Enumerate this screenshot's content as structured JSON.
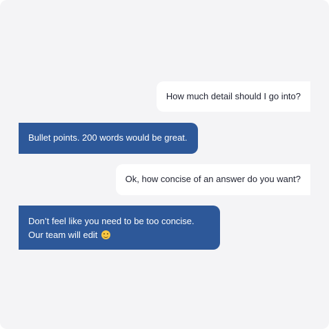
{
  "messages": [
    {
      "sender": "outgoing",
      "text": "How much detail should I go into?"
    },
    {
      "sender": "incoming",
      "text": "Bullet points. 200 words would be great."
    },
    {
      "sender": "outgoing",
      "text": "Ok, how concise of an answer do you want?"
    },
    {
      "sender": "incoming",
      "text": "Don’t feel like you need to be too concise. Our team will edit",
      "icon": "smiling-face-emoji-icon"
    }
  ],
  "colors": {
    "background": "#f4f4f6",
    "outgoing_bubble": "#ffffff",
    "incoming_bubble": "#2d5899"
  }
}
